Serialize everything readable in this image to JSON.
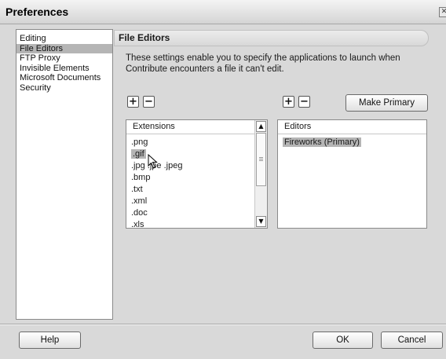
{
  "window": {
    "title": "Preferences"
  },
  "sidebar": {
    "items": [
      {
        "label": "Editing"
      },
      {
        "label": "File Editors",
        "selected": true
      },
      {
        "label": "FTP Proxy"
      },
      {
        "label": "Invisible Elements"
      },
      {
        "label": "Microsoft Documents"
      },
      {
        "label": "Security"
      }
    ]
  },
  "panel": {
    "title": "File Editors",
    "description_line1": "These settings enable you to specify the applications to launch when",
    "description_line2": "Contribute encounters a file it can't edit."
  },
  "extensions": {
    "add_icon": "plus-icon",
    "remove_icon": "minus-icon",
    "header": "Extensions",
    "items": [
      ".png",
      ".gif",
      ".jpg .jpe .jpeg",
      ".bmp",
      ".txt",
      ".xml",
      ".doc",
      ".xls"
    ],
    "selected_index": 1
  },
  "editors": {
    "add_icon": "plus-icon",
    "remove_icon": "minus-icon",
    "make_primary_label": "Make Primary",
    "header": "Editors",
    "items": [
      "Fireworks (Primary)"
    ]
  },
  "buttons": {
    "help": "Help",
    "ok": "OK",
    "cancel": "Cancel"
  }
}
